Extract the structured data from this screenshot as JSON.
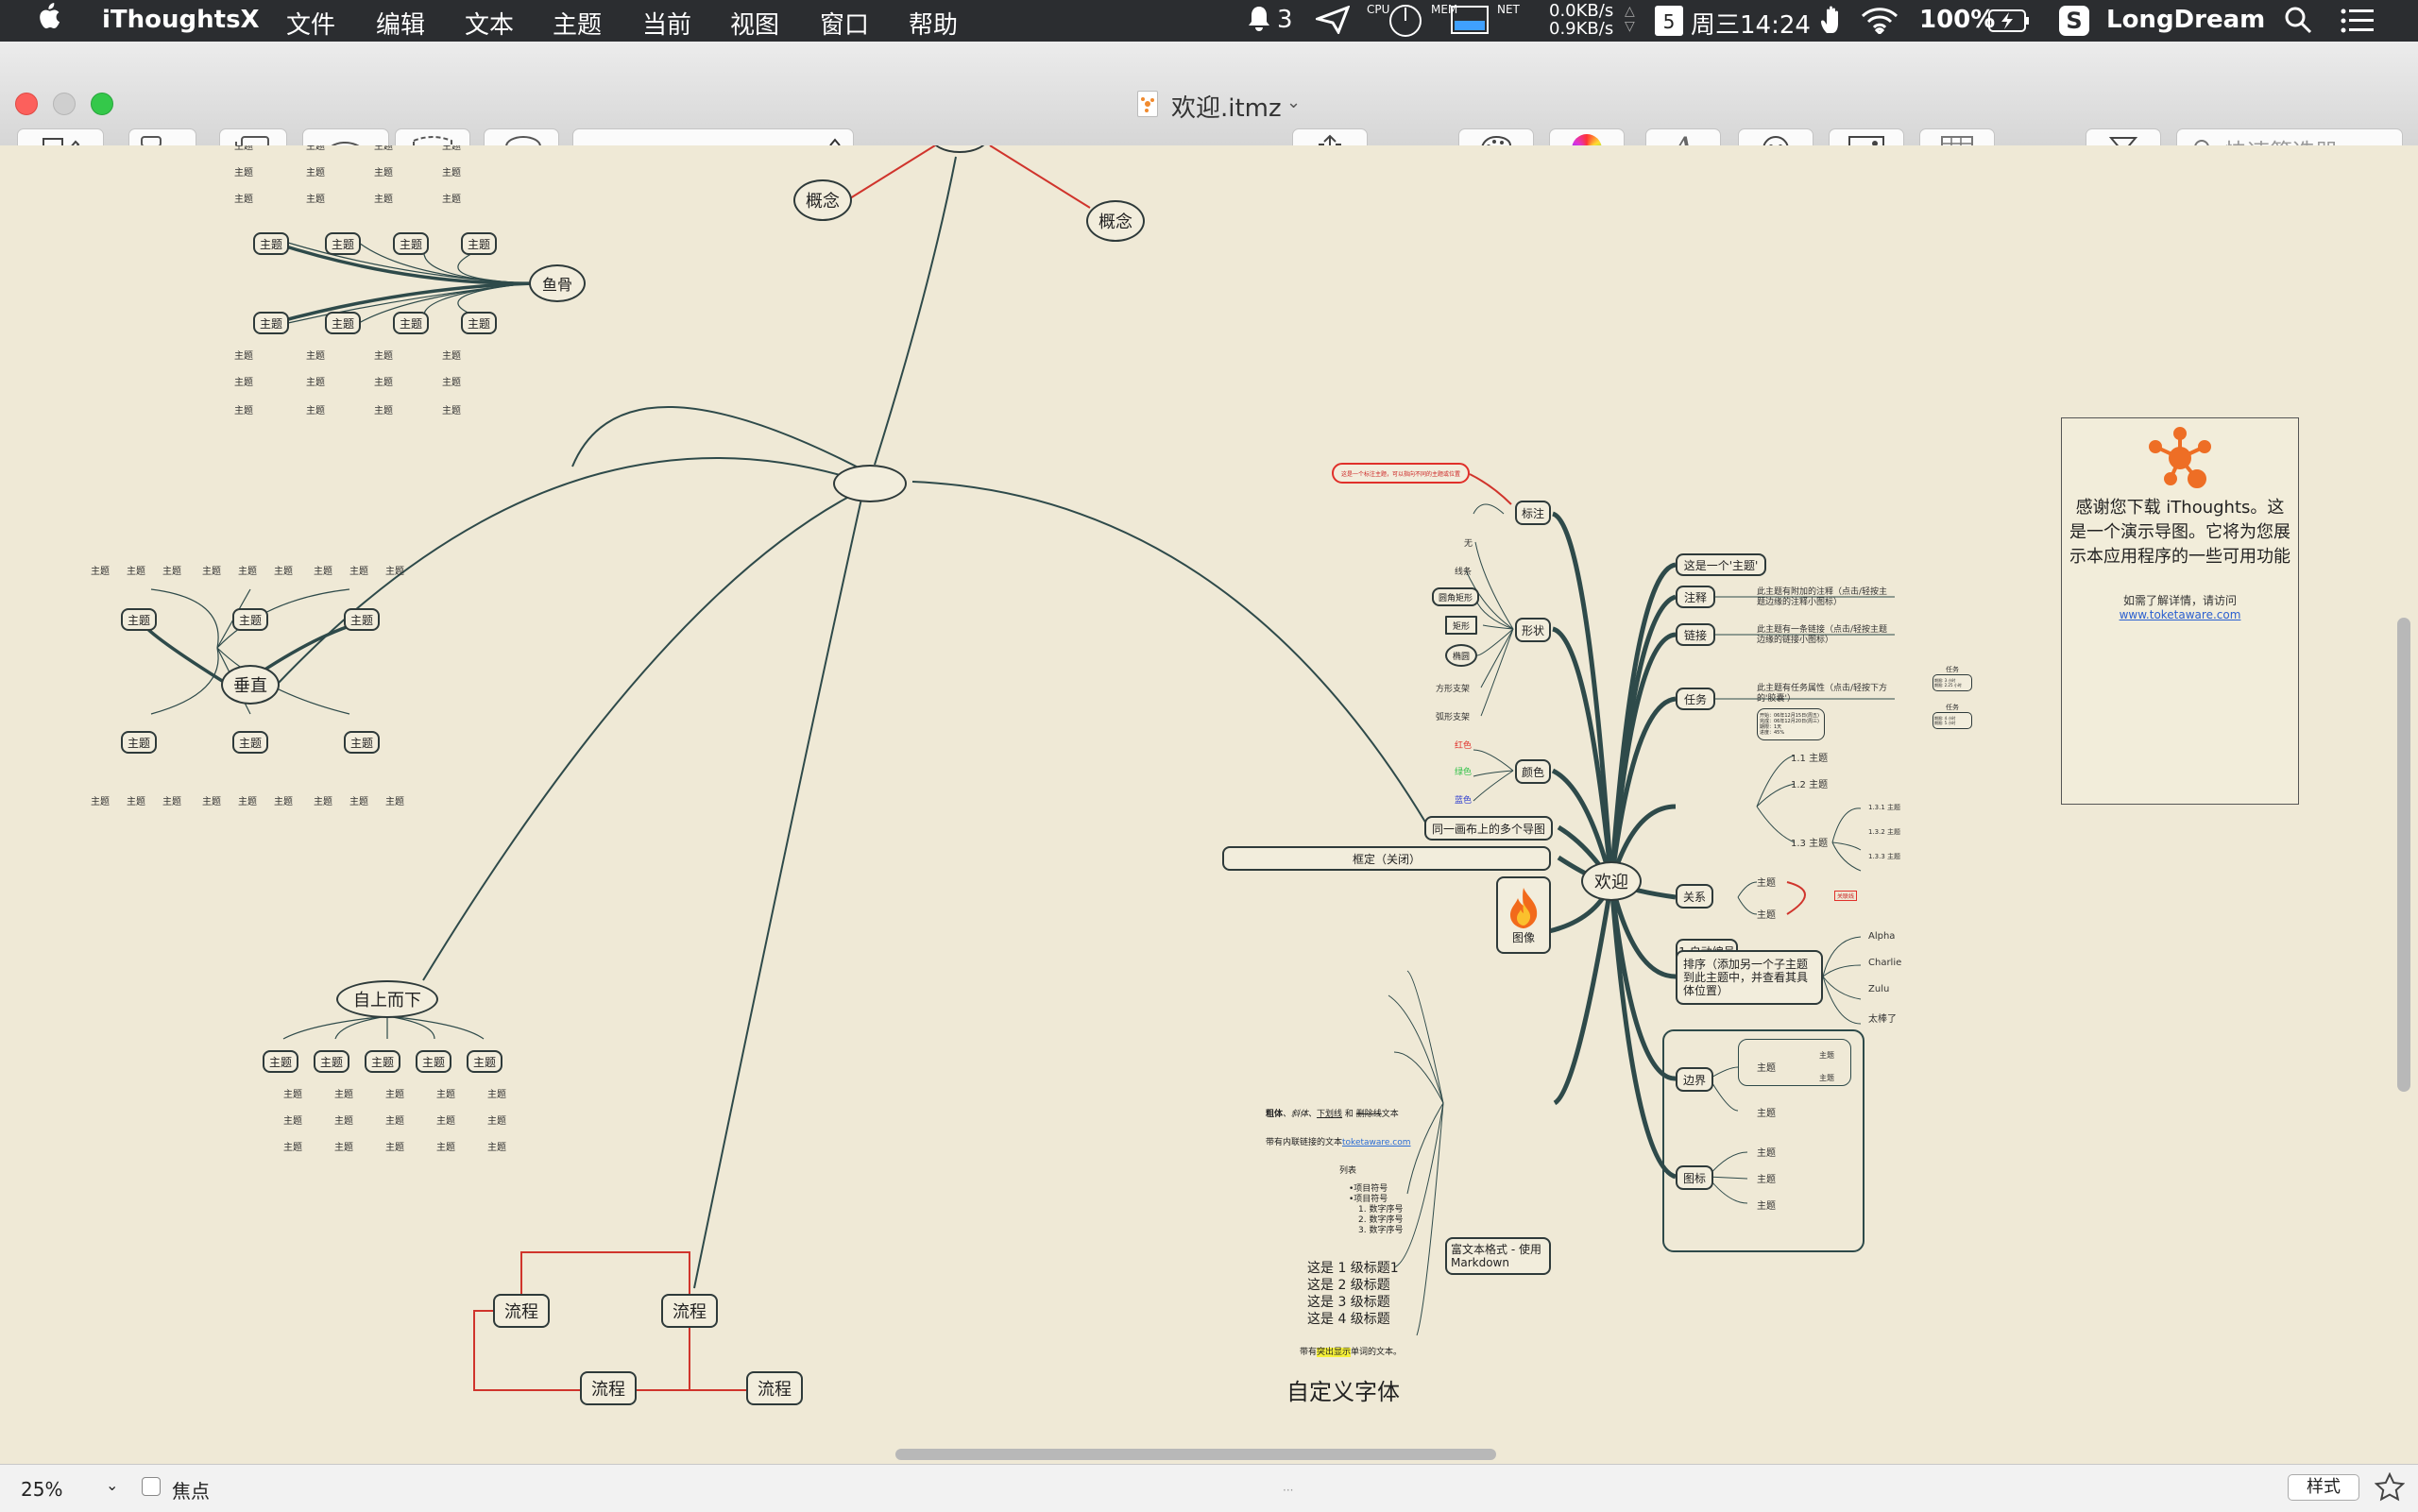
{
  "menubar": {
    "apple": "",
    "app": "iThoughtsX",
    "items": [
      "文件",
      "编辑",
      "文本",
      "主题",
      "当前",
      "视图",
      "窗口",
      "帮助"
    ],
    "status": {
      "notifications": "3",
      "mem": "MEM",
      "net": "NET",
      "cpu": "CPU",
      "net_up": "0.0KB/s",
      "net_down": "0.9KB/s",
      "calendar_day": "5",
      "clock": "周三14:24",
      "battery": "100%",
      "user": "LongDream"
    }
  },
  "window": {
    "title": "欢迎.itmz"
  },
  "toolbar": {
    "search_placeholder": "快速筛选器"
  },
  "mindmap": {
    "center": "",
    "concept_nodes": [
      "概念",
      "概念"
    ],
    "fishbone": {
      "label": "鱼骨",
      "topic": "主题"
    },
    "vertical": {
      "label": "垂直",
      "topic": "主题"
    },
    "topdown": {
      "label": "自上而下",
      "topic": "主题"
    },
    "flow": {
      "label": "流程"
    },
    "welcome": {
      "label": "欢迎",
      "left": {
        "callout": "标注",
        "callout_note": "这是一个标注主题，可以指向不同的主题或位置",
        "shape": "形状",
        "shape_options": [
          "无",
          "线条",
          "圆角矩形",
          "矩形",
          "椭圆",
          "方形支架",
          "弧形支架"
        ],
        "color": "颜色",
        "colors": [
          "红色",
          "绿色",
          "蓝色"
        ],
        "multimap": "同一画布上的多个导图",
        "frame": "框定（关闭）",
        "image": "图像",
        "rich": "富文本格式 - 使用 Markdown",
        "rich_bold": "粗体",
        "rich_italic": "、斜体、",
        "rich_underline": "下划线",
        "rich_and": " 和 ",
        "rich_strike": "删除线",
        "rich_text": "文本",
        "rich_link_pre": "带有内联链接的文本",
        "rich_link": "toketaware.com",
        "rich_list": "列表",
        "rich_bullets": [
          "•项目符号",
          "•项目符号"
        ],
        "rich_numbers": [
          "1. 数字序号",
          "2. 数字序号",
          "3. 数字序号"
        ],
        "rich_headings": [
          "这是 1 级标题1",
          "这是 2 级标题",
          "这是 3 级标题",
          "这是 4 级标题"
        ],
        "rich_hl_pre": "带有",
        "rich_hl": "突出显示",
        "rich_hl_post": "单词的文本。",
        "rich_font": "自定义字体"
      },
      "right": {
        "topic": "这是一个'主题'",
        "notes": "注释",
        "notes_text": "此主题有附加的注释（点击/轻按主题边缘的注释小图标）",
        "link": "链接",
        "link_text": "此主题有一条链接（点击/轻按主题边缘的链接小图标）",
        "task": "任务",
        "task_text": "此主题有任务属性（点击/轻按下方的'胶囊'）",
        "task_sub": "任务",
        "task_detail": [
          "开始：06年12月15日(周五)",
          "完成：06年12月20日(周三)",
          "期限：1天",
          "进度：45%"
        ],
        "task_mini": [
          "期限: 3 小时",
          "期限: 2.25 小时",
          "期限: 4 小时",
          "期限: 5 小时"
        ],
        "autonum": "1 自动编号",
        "autonum_items": [
          "1.1 主题",
          "1.2 主题",
          "1.3 主题"
        ],
        "autonum_sub": [
          "1.3.1 主题",
          "1.3.2 主题",
          "1.3.3 主题"
        ],
        "relation": "关系",
        "relation_topic": "主题",
        "relation_label": "关联线",
        "sort": "排序（添加另一个子主题到此主题中，并查看其具体位置）",
        "sort_items": [
          "Alpha",
          "Charlie",
          "Zulu",
          "太棒了"
        ],
        "boundary": "边界",
        "boundary_topic": "主题",
        "icons": "图标",
        "icons_topic": "主题"
      }
    },
    "info": {
      "text": "感谢您下载 iThoughts。这是一个演示导图。它将为您展示本应用程序的一些可用功能",
      "sub": "如需了解详情，请访问",
      "link": "www.toketaware.com"
    }
  },
  "statusbar": {
    "zoom": "25%",
    "focus": "焦点",
    "style": "样式"
  },
  "colors": {
    "canvas": "#efe9d6",
    "line": "#2e3a3a",
    "accent_red": "#e0302a",
    "accent_green": "#33c24a",
    "accent_blue": "#2b3bd0"
  }
}
